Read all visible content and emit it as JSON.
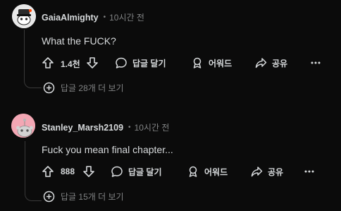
{
  "comments": [
    {
      "username": "GaiaAlmighty",
      "separator": "•",
      "time": "10시간 전",
      "body": "What the FUCK?",
      "vote_count": "1.4천",
      "reply_label": "답글 달기",
      "award_label": "어워드",
      "share_label": "공유",
      "more_replies": "답글 28개 더 보기",
      "avatar_icon": "snoo-avatar-gray",
      "avatar_bg": "#e9e9e9"
    },
    {
      "username": "Stanley_Marsh2109",
      "separator": "•",
      "time": "10시간 전",
      "body": "Fuck you mean final chapter...",
      "vote_count": "888",
      "reply_label": "답글 달기",
      "award_label": "어워드",
      "share_label": "공유",
      "more_replies": "답글 15개 더 보기",
      "avatar_icon": "snoo-avatar-pink",
      "avatar_bg": "#f3a7b4"
    }
  ],
  "colors": {
    "background": "#0b0b0b",
    "text": "#d7dadc",
    "muted": "#818384",
    "thread_line": "#3a3a3a"
  }
}
